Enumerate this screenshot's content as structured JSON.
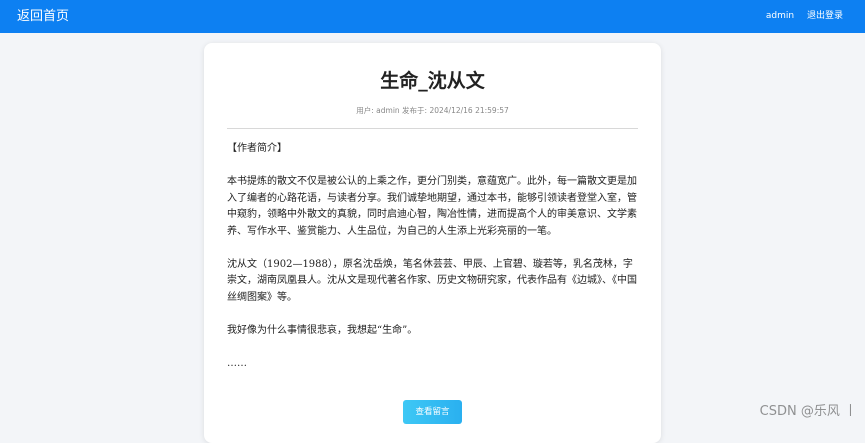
{
  "header": {
    "home_link": "返回首页",
    "username": "admin",
    "logout": "退出登录"
  },
  "article": {
    "title": "生命_沈从文",
    "meta": {
      "user_label": "用户:",
      "username": "admin",
      "posted_label": "发布于:",
      "datetime": "2024/12/16 21:59:57"
    },
    "paragraphs": [
      "【作者简介】",
      "本书提炼的散文不仅是被公认的上乘之作，更分门别类，意蕴宽广。此外，每一篇散文更是加入了编者的心路花语，与读者分享。我们诚挚地期望，通过本书，能够引领读者登堂入室，管中窥豹，领略中外散文的真貌，同时启迪心智，陶冶性情，进而提高个人的审美意识、文学素养、写作水平、鉴赏能力、人生品位，为自己的人生添上光彩亮丽的一笔。",
      "沈从文（1902—1988），原名沈岳焕，笔名休芸芸、甲辰、上官碧、璇若等，乳名茂林，字崇文，湖南凤凰县人。沈从文是现代著名作家、历史文物研究家，代表作品有《边城》、《中国丝绸图案》等。",
      "我好像为什么事情很悲哀，我想起“生命”。",
      "……"
    ],
    "comments_button": "查看留言"
  },
  "watermark": "CSDN @乐风 丨"
}
